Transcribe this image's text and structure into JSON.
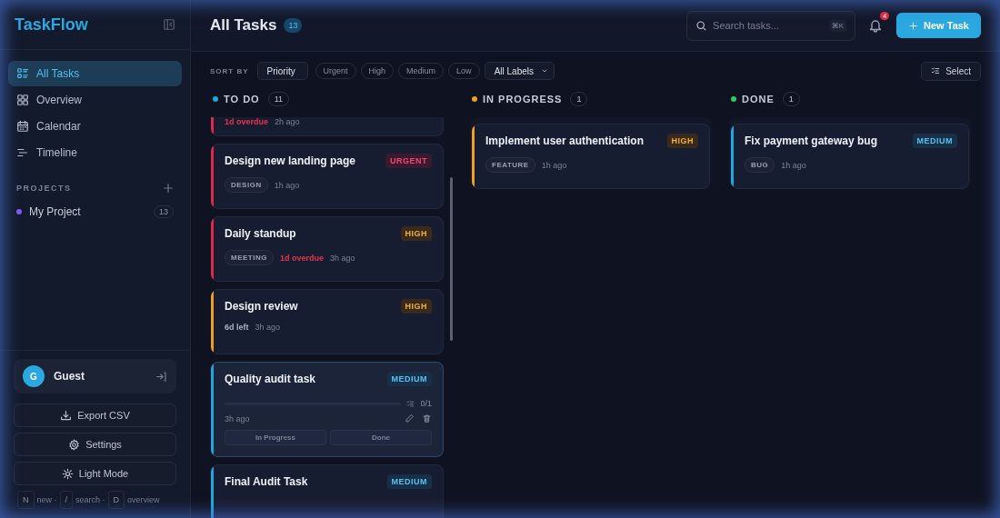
{
  "sidebar": {
    "logo": "TaskFlow",
    "nav": [
      {
        "label": "All Tasks",
        "selected": true
      },
      {
        "label": "Overview",
        "selected": false
      },
      {
        "label": "Calendar",
        "selected": false
      },
      {
        "label": "Timeline",
        "selected": false
      }
    ],
    "projects_heading": "PROJECTS",
    "projects": [
      {
        "name": "My Project",
        "count": "13",
        "color": "#7c5cf0"
      }
    ],
    "user": {
      "initial": "G",
      "name": "Guest"
    },
    "actions": [
      {
        "label": "Export CSV"
      },
      {
        "label": "Settings"
      },
      {
        "label": "Light Mode"
      }
    ],
    "shortcuts": [
      {
        "key": "N",
        "label": "new ·"
      },
      {
        "key": "/",
        "label": "search ·"
      },
      {
        "key": "D",
        "label": "overview"
      }
    ]
  },
  "header": {
    "title": "All Tasks",
    "count": "13",
    "search": {
      "placeholder": "Search tasks...",
      "shortcut": "⌘K"
    },
    "notifications": "4",
    "new_button": "New Task"
  },
  "toolbar": {
    "sort_label": "SORT BY",
    "sort": "Priority",
    "filters": [
      {
        "label": "Urgent",
        "selected": false
      },
      {
        "label": "High",
        "selected": false
      },
      {
        "label": "Medium",
        "selected": false
      },
      {
        "label": "Low",
        "selected": false
      }
    ],
    "labels": "All Labels",
    "select_button": "Select"
  },
  "columns": [
    {
      "title": "TO DO",
      "count": "11",
      "color": "#1ea7e0",
      "cards": [
        {
          "partial": true,
          "color": "#e0294f",
          "expanded": false,
          "due": {
            "text": "1d overdue",
            "kind": "overdue"
          },
          "time": "2h ago"
        },
        {
          "title": "Design new landing page",
          "priority": {
            "label": "URGENT",
            "kind": "urgent"
          },
          "color": "#e0294f",
          "expanded": false,
          "tags": [
            "DESIGN"
          ],
          "time": "1h ago"
        },
        {
          "title": "Daily standup",
          "priority": {
            "label": "HIGH",
            "kind": "high"
          },
          "color": "#e0294f",
          "expanded": false,
          "tags": [
            "MEETING"
          ],
          "due": {
            "text": "1d overdue",
            "kind": "overdue"
          },
          "time": "3h ago"
        },
        {
          "title": "Design review",
          "priority": {
            "label": "HIGH",
            "kind": "high"
          },
          "color": "#f0a020",
          "expanded": false,
          "due": {
            "text": "6d left",
            "kind": "left"
          },
          "time": "3h ago"
        },
        {
          "title": "Quality audit task",
          "priority": {
            "label": "MEDIUM",
            "kind": "medium"
          },
          "color": "#1ea7e0",
          "expanded": true,
          "subtasks": {
            "level": 0,
            "text": "0/1"
          },
          "time": "3h ago",
          "moves": [
            "In Progress",
            "Done"
          ]
        },
        {
          "title": "Final Audit Task",
          "priority": {
            "label": "MEDIUM",
            "kind": "medium"
          },
          "color": "#1ea7e0",
          "expanded": false
        }
      ]
    },
    {
      "title": "IN PROGRESS",
      "count": "1",
      "color": "#f0a020",
      "cards": [
        {
          "title": "Implement user authentication",
          "priority": {
            "label": "HIGH",
            "kind": "high"
          },
          "color": "#f0a020",
          "expanded": false,
          "tags": [
            "FEATURE"
          ],
          "time": "1h ago"
        }
      ]
    },
    {
      "title": "DONE",
      "count": "1",
      "color": "#2ecc60",
      "cards": [
        {
          "title": "Fix payment gateway bug",
          "priority": {
            "label": "MEDIUM",
            "kind": "medium"
          },
          "color": "#1ea7e0",
          "expanded": false,
          "tags": [
            "BUG"
          ],
          "time": "1h ago"
        }
      ]
    }
  ]
}
